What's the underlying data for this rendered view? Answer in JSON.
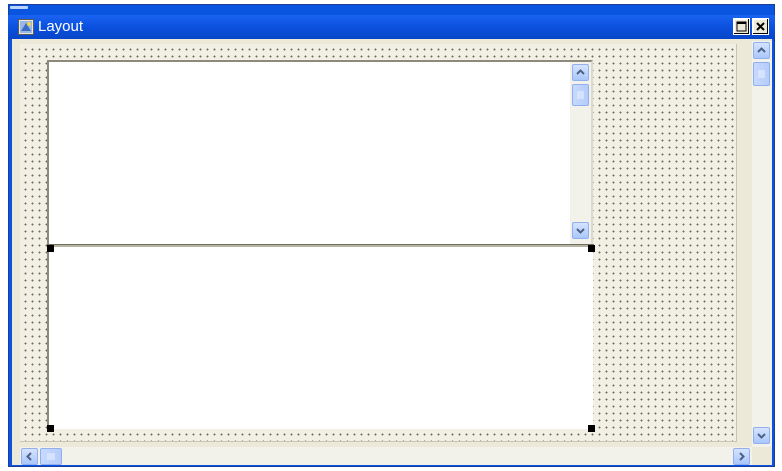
{
  "window": {
    "title": "Layout",
    "icon": "layout-app-icon",
    "controls": [
      "maximize-icon",
      "close-icon"
    ]
  },
  "colors": {
    "titlebar": "#0a55df",
    "canvas_background": "#f2f0e4",
    "grid_dot": "#6d6a5e",
    "selection_handle": "#000000",
    "scrollbar_button": "#c1d3fb"
  },
  "icons": {
    "scroll_up": "chevron-up-icon",
    "scroll_down": "chevron-down-icon",
    "scroll_left": "chevron-left-icon",
    "scroll_right": "chevron-right-icon",
    "thumb_grip": "grip-lines-icon"
  }
}
